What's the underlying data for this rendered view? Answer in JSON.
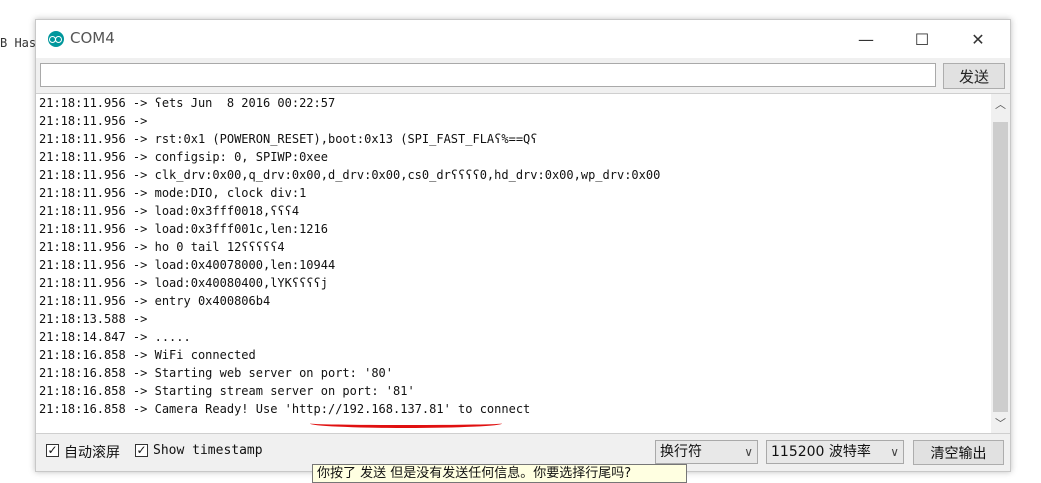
{
  "background": {
    "text": "B Has"
  },
  "window": {
    "title": "COM4",
    "controls": {
      "minimize": "—",
      "maximize": "☐",
      "close": "✕"
    }
  },
  "send": {
    "input_value": "",
    "button_label": "发送"
  },
  "log_lines": [
    "21:18:11.956 -> ʕets Jun  8 2016 00:22:57",
    "21:18:11.956 ->",
    "21:18:11.956 -> rst:0x1 (POWERON_RESET),boot:0x13 (SPI_FAST_FLAʕ%==Qʕ",
    "21:18:11.956 -> configsip: 0, SPIWP:0xee",
    "21:18:11.956 -> clk_drv:0x00,q_drv:0x00,d_drv:0x00,cs0_drʕʕʕʕ0,hd_drv:0x00,wp_drv:0x00",
    "21:18:11.956 -> mode:DIO, clock div:1",
    "21:18:11.956 -> load:0x3fff0018,ʕʕʕ4",
    "21:18:11.956 -> load:0x3fff001c,len:1216",
    "21:18:11.956 -> ho 0 tail 12ʕʕʕʕʕ4",
    "21:18:11.956 -> load:0x40078000,len:10944",
    "21:18:11.956 -> load:0x40080400,lYKʕʕʕʕj",
    "21:18:11.956 -> entry 0x400806b4",
    "21:18:13.588 ->",
    "21:18:14.847 -> .....",
    "21:18:16.858 -> WiFi connected",
    "21:18:16.858 -> Starting web server on port: '80'",
    "21:18:16.858 -> Starting stream server on port: '81'",
    "21:18:16.858 -> Camera Ready! Use 'http://192.168.137.81' to connect"
  ],
  "scrollbar": {
    "up": "︿",
    "down": "﹀"
  },
  "bottom": {
    "autoscroll": {
      "checked": true,
      "label": "自动滚屏"
    },
    "timestamp": {
      "checked": true,
      "label": "Show timestamp"
    },
    "line_ending": "换行符",
    "baud_rate": "115200 波特率",
    "clear_button": "清空输出",
    "check_mark": "✓",
    "chevron": "∨"
  },
  "tooltip": "你按了 发送 但是没有发送任何信息。你要选择行尾吗?"
}
